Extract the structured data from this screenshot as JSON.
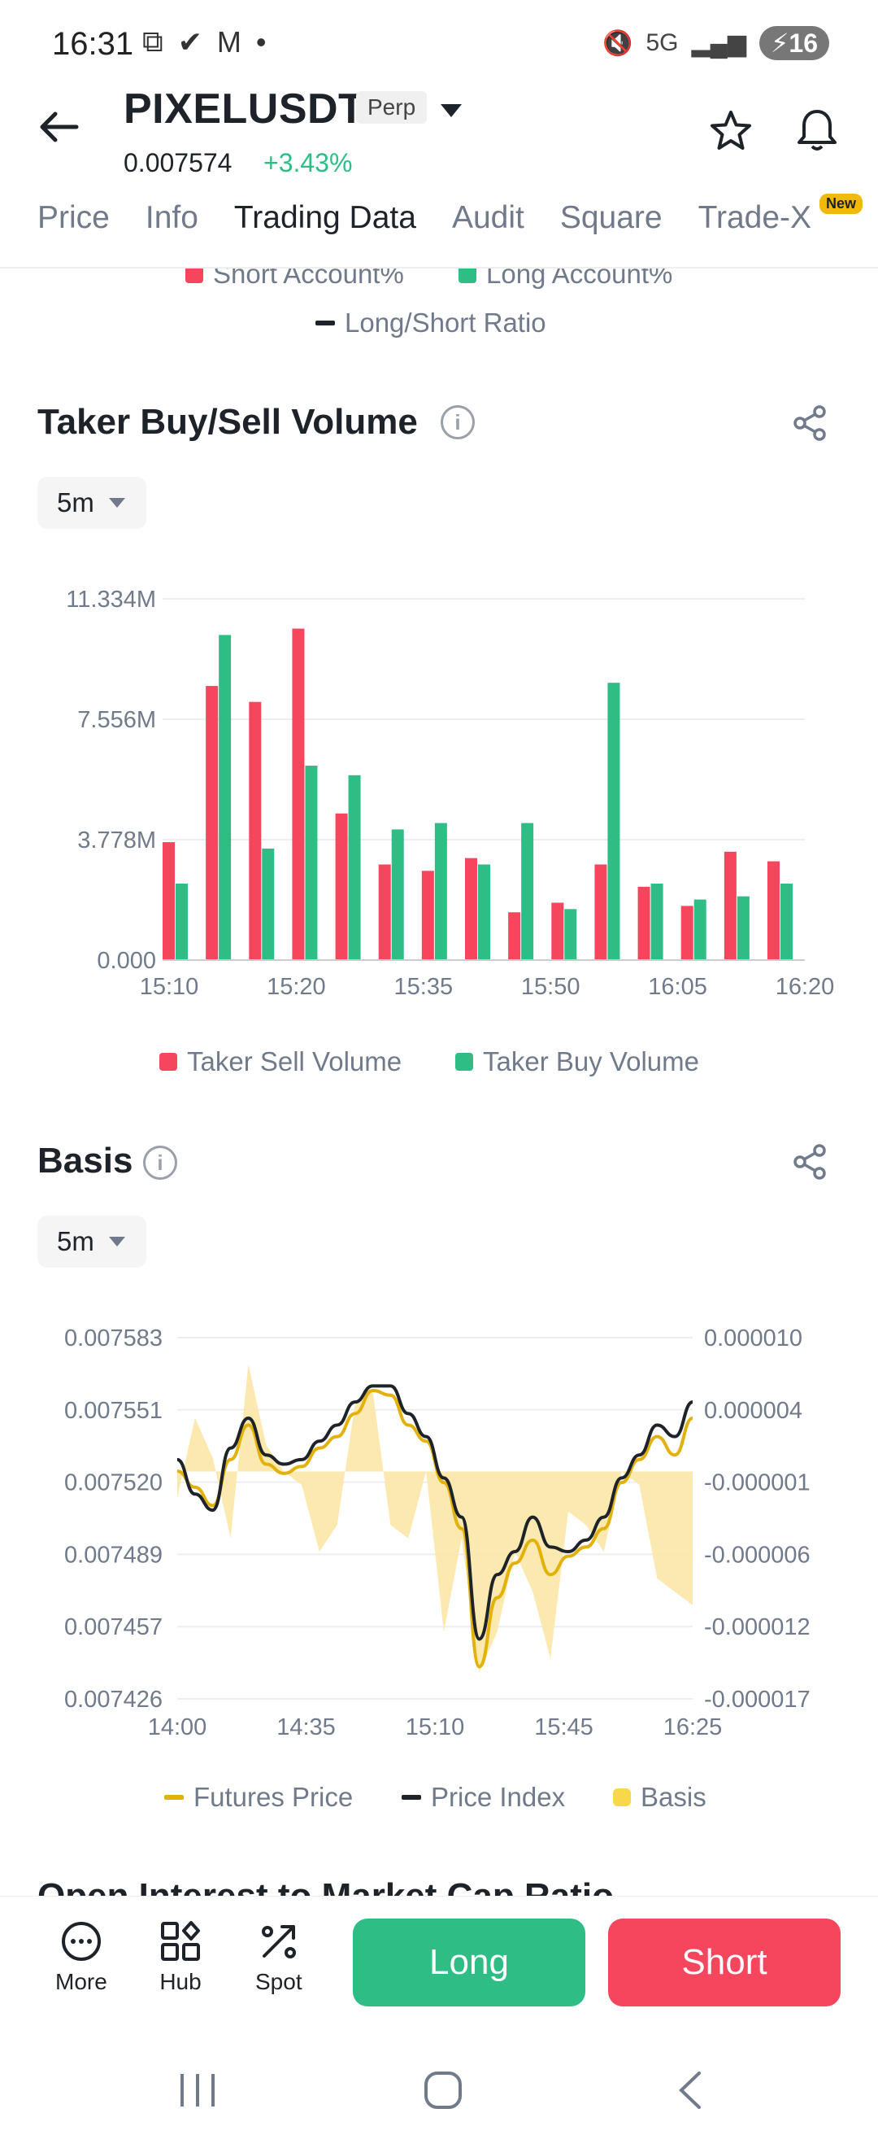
{
  "status": {
    "time": "16:31",
    "battery": "16",
    "network": "5G"
  },
  "header": {
    "symbol": "PIXELUSDT",
    "contract_type": "Perp",
    "price": "0.007574",
    "change": "+3.43%"
  },
  "tabs": [
    {
      "label": "Price"
    },
    {
      "label": "Info"
    },
    {
      "label": "Trading Data"
    },
    {
      "label": "Audit"
    },
    {
      "label": "Square"
    },
    {
      "label": "Trade-X"
    }
  ],
  "new_badge": "New",
  "prev_legend": {
    "short": "Short Account%",
    "long": "Long Account%",
    "ratio": "Long/Short Ratio"
  },
  "taker": {
    "title": "Taker Buy/Sell Volume",
    "interval": "5m",
    "legend_sell": "Taker Sell Volume",
    "legend_buy": "Taker Buy Volume"
  },
  "basis": {
    "title": "Basis",
    "interval": "5m",
    "legend_futures": "Futures Price",
    "legend_index": "Price Index",
    "legend_basis": "Basis"
  },
  "next_section_title": "Open Interest to Market Cap Ratio",
  "bottom": {
    "more": "More",
    "hub": "Hub",
    "spot": "Spot",
    "long": "Long",
    "short": "Short"
  },
  "colors": {
    "sell": "#f6465d",
    "buy": "#2ebd85",
    "futures": "#e2b20a",
    "index": "#1e2329",
    "basis": "#fbe7a6"
  },
  "chart_data": [
    {
      "type": "bar",
      "title": "Taker Buy/Sell Volume",
      "x_ticks": [
        "15:10",
        "15:20",
        "15:35",
        "15:50",
        "16:05",
        "16:20"
      ],
      "y_ticks": [
        "0.000",
        "3.778M",
        "7.556M",
        "11.334M"
      ],
      "ylim": [
        0,
        11334000
      ],
      "categories": [
        "15:10",
        "15:15",
        "15:20",
        "15:25",
        "15:30",
        "15:35",
        "15:40",
        "15:45",
        "15:50",
        "15:55",
        "16:00",
        "16:05",
        "16:10",
        "16:15",
        "16:20"
      ],
      "series": [
        {
          "name": "Taker Sell Volume",
          "values": [
            3700000.0,
            8600000.0,
            8100000.0,
            10400000.0,
            4600000.0,
            3000000.0,
            2800000.0,
            3200000.0,
            1500000.0,
            1800000.0,
            3000000.0,
            2300000.0,
            1700000.0,
            3400000.0,
            3100000.0
          ]
        },
        {
          "name": "Taker Buy Volume",
          "values": [
            2400000.0,
            10200000.0,
            3500000.0,
            6100000.0,
            5800000.0,
            4100000.0,
            4300000.0,
            3000000.0,
            4300000.0,
            1600000.0,
            8700000.0,
            2400000.0,
            1900000.0,
            2000000.0,
            2400000.0
          ]
        }
      ]
    },
    {
      "type": "line",
      "title": "Basis",
      "x_ticks": [
        "14:00",
        "14:35",
        "15:10",
        "15:45",
        "16:25"
      ],
      "y_left_ticks": [
        "0.007426",
        "0.007457",
        "0.007489",
        "0.007520",
        "0.007551",
        "0.007583"
      ],
      "y_right_ticks": [
        "-0.000017",
        "-0.000012",
        "-0.000006",
        "-0.000001",
        "0.000004",
        "0.000010"
      ],
      "ylim_left": [
        0.007426,
        0.007583
      ],
      "ylim_right": [
        -1.7e-05,
        1e-05
      ],
      "x_minutes": [
        0,
        5,
        10,
        15,
        20,
        25,
        30,
        35,
        40,
        45,
        50,
        55,
        60,
        65,
        70,
        75,
        80,
        85,
        90,
        95,
        100,
        105,
        110,
        115,
        120,
        125,
        130,
        135,
        140,
        145
      ],
      "series": [
        {
          "name": "Futures Price",
          "values": [
            0.007525,
            0.007518,
            0.00751,
            0.00753,
            0.007545,
            0.007528,
            0.007524,
            0.007527,
            0.007535,
            0.00754,
            0.00755,
            0.00756,
            0.007558,
            0.007545,
            0.007538,
            0.00752,
            0.0075,
            0.00744,
            0.00747,
            0.007485,
            0.007495,
            0.00748,
            0.007488,
            0.007492,
            0.0075,
            0.00752,
            0.00753,
            0.00754,
            0.007532,
            0.007548
          ]
        },
        {
          "name": "Price Index",
          "values": [
            0.00753,
            0.007515,
            0.007508,
            0.007535,
            0.007548,
            0.007532,
            0.007528,
            0.00753,
            0.007538,
            0.007545,
            0.007555,
            0.007562,
            0.007562,
            0.00755,
            0.00754,
            0.007522,
            0.007505,
            0.007452,
            0.00748,
            0.00749,
            0.007505,
            0.007492,
            0.00749,
            0.007495,
            0.007505,
            0.007522,
            0.007532,
            0.007545,
            0.00754,
            0.007555
          ]
        },
        {
          "name": "Basis",
          "values": [
            -2e-06,
            4e-06,
            1e-06,
            -5e-06,
            8e-06,
            2e-06,
            0.0,
            -1e-06,
            -6e-06,
            -4e-06,
            5e-06,
            6e-06,
            -4e-06,
            -5e-06,
            0.0,
            -1.2e-05,
            -5e-06,
            -1.5e-05,
            -1.2e-05,
            -6e-06,
            -9e-06,
            -1.4e-05,
            -3e-06,
            -4e-06,
            -6e-06,
            0.0,
            -1e-06,
            -8e-06,
            -9e-06,
            -1e-05
          ]
        }
      ]
    }
  ]
}
